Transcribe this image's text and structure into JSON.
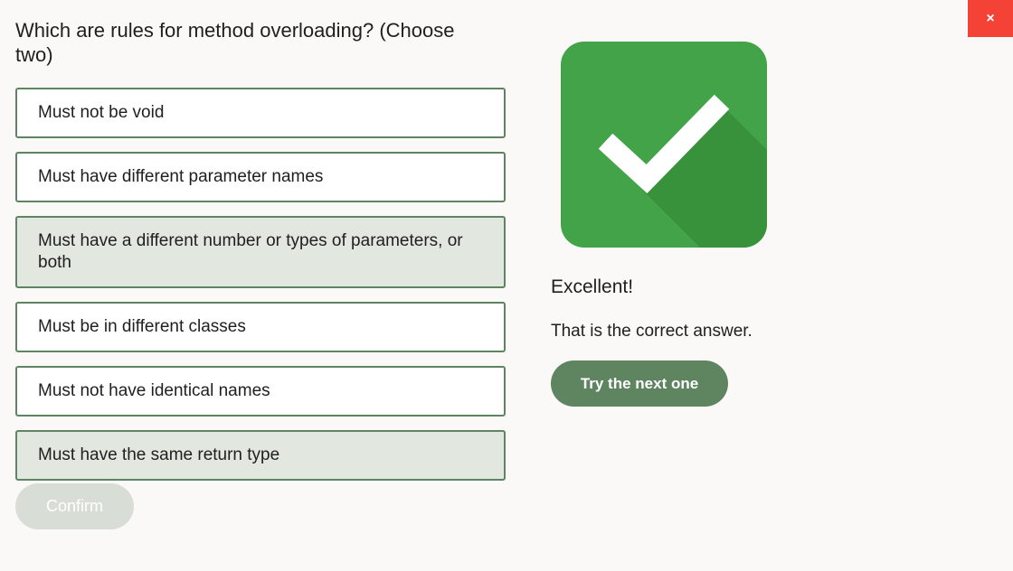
{
  "close": {
    "label": "×"
  },
  "question": {
    "text": "Which are rules for method overloading? (Choose two)"
  },
  "options": [
    {
      "label": "Must not be void",
      "selected": false
    },
    {
      "label": "Must have different parameter names",
      "selected": false
    },
    {
      "label": "Must have a different number or types of parameters, or both",
      "selected": true
    },
    {
      "label": "Must be in different classes",
      "selected": false
    },
    {
      "label": "Must not have identical names",
      "selected": false
    },
    {
      "label": "Must have the same return type",
      "selected": true
    }
  ],
  "confirm": {
    "label": "Confirm",
    "enabled": false
  },
  "feedback": {
    "icon": "checkmark-icon",
    "title": "Excellent!",
    "message": "That is the correct answer.",
    "next_label": "Try the next one"
  },
  "colors": {
    "accent_green": "#5e8460",
    "icon_green": "#43a348",
    "selected_bg": "#e2e7e0",
    "close_red": "#f44336"
  }
}
